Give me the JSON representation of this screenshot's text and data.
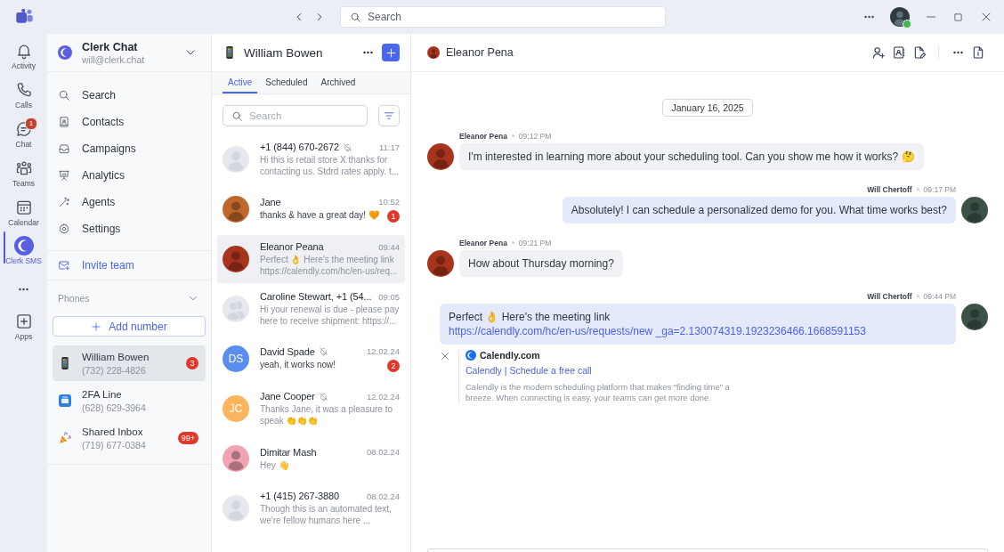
{
  "title_bar": {
    "search": {
      "placeholder": "Search"
    },
    "user": {
      "online": true
    }
  },
  "rail": {
    "items": [
      {
        "label": "Activity",
        "selected": false
      },
      {
        "label": "Calls",
        "selected": false
      },
      {
        "label": "Chat",
        "selected": false,
        "badge": "1"
      },
      {
        "label": "Teams",
        "selected": false
      },
      {
        "label": "Calendar",
        "selected": false
      },
      {
        "label": "Clerk SMS",
        "selected": true
      }
    ],
    "apps": {
      "label": "Apps"
    }
  },
  "sidebar": {
    "account": {
      "name": "Clerk Chat",
      "email": "will@clerk.chat"
    },
    "menu": [
      {
        "label": "Search"
      },
      {
        "label": "Contacts"
      },
      {
        "label": "Campaigns"
      },
      {
        "label": "Analytics"
      },
      {
        "label": "Agents"
      },
      {
        "label": "Settings"
      }
    ],
    "invite": {
      "label": "Invite team"
    },
    "phones": {
      "title": "Phones",
      "expanded": true,
      "add_label": "Add number",
      "lines": [
        {
          "name": "William Bowen",
          "number": "(732) 228-4826",
          "selected": true,
          "badge": "3"
        },
        {
          "name": "2FA Line",
          "number": "(628) 629-3964",
          "selected": false
        },
        {
          "name": "Shared Inbox",
          "number": "(719) 677-0384",
          "selected": false,
          "badge": "99+"
        }
      ]
    }
  },
  "conversations": {
    "title": "William Bowen",
    "tabs": [
      {
        "label": "Active",
        "selected": true
      },
      {
        "label": "Scheduled",
        "selected": false
      },
      {
        "label": "Archived",
        "selected": false
      }
    ],
    "search": {
      "placeholder": "Search"
    },
    "items": [
      {
        "name": "+1 (844) 670-2672",
        "time": "11:17",
        "preview": "Hi this is retail store X thanks for contacting us. Stdrd rates apply. t...",
        "muted": true,
        "selected": false,
        "avatar": {
          "kind": "placeholder"
        }
      },
      {
        "name": "Jane",
        "time": "10:52",
        "preview": "thanks & have a great day! 🧡",
        "muted": false,
        "selected": false,
        "badge": "1",
        "avatar": {
          "kind": "photo",
          "color": "#c0682c"
        }
      },
      {
        "name": "Eleanor Peana",
        "time": "09:44",
        "preview": "Perfect 👌 Here's the meeting link https://calendly.com/hc/en-us/req...",
        "muted": false,
        "selected": true,
        "avatar": {
          "kind": "photo",
          "color": "#a8341d"
        }
      },
      {
        "name": "Caroline Stewart, +1 (54...",
        "time": "09:05",
        "preview": "Hi your renewal is due - please pay here to receive shipment: https://...",
        "muted": false,
        "selected": false,
        "avatar": {
          "kind": "group"
        }
      },
      {
        "name": "David Spade",
        "time": "12.02.24",
        "preview": "yeah, it works now!",
        "muted": true,
        "selected": false,
        "badge": "2",
        "avatar": {
          "kind": "initials",
          "initials": "DS",
          "color": "#5b8def"
        }
      },
      {
        "name": "Jane Cooper",
        "time": "12.02.24",
        "preview": "Thanks Jane, it was a pleasure to speak 👏👏👏",
        "muted": true,
        "selected": false,
        "avatar": {
          "kind": "initials",
          "initials": "JC",
          "color": "#fbb55c"
        }
      },
      {
        "name": "Dimitar Mash",
        "time": "08.02.24",
        "preview": "Hey 👋",
        "muted": false,
        "selected": false,
        "avatar": {
          "kind": "photo",
          "color": "#f2a3b3"
        }
      },
      {
        "name": "+1 (415) 267-3880",
        "time": "08.02.24",
        "preview": "Though this is an automated text, we're fellow humans here ...",
        "muted": false,
        "selected": false,
        "avatar": {
          "kind": "placeholder"
        }
      }
    ]
  },
  "chat": {
    "contact": {
      "name": "Eleanor Pena",
      "avatar": {
        "color": "#a8341d"
      }
    },
    "date": "January 16, 2025",
    "messages": [
      {
        "outgoing": false,
        "sender": "Eleanor Pena",
        "time": "09:12 PM",
        "text": "I'm interested in learning more about your scheduling tool. Can you show me how it works? 🤔",
        "avatar": {
          "color": "#a8341d"
        }
      },
      {
        "outgoing": true,
        "sender": "Will Chertoff",
        "time": "09:17 PM",
        "text": "Absolutely! I can schedule a personalized demo for you. What time works best?",
        "avatar": {
          "color": "#3d5247"
        }
      },
      {
        "outgoing": false,
        "sender": "Eleanor Pena",
        "time": "09:21 PM",
        "text": "How about Thursday morning?",
        "avatar": {
          "color": "#a8341d"
        }
      },
      {
        "outgoing": true,
        "sender": "Will Chertoff",
        "time": "09:44 PM",
        "text": "Perfect 👌 Here's the meeting link",
        "link": "https://calendly.com/hc/en-us/requests/new _ga=2.130074319.1923236466.1668591153",
        "avatar": {
          "color": "#3d5247"
        },
        "preview": {
          "site": "Calendly.com",
          "title": "Calendly | Schedule a free call",
          "description": "Calendly is the modern scheduling platform that makes “finding time” a breeze. When connecting is easy, your teams can get more done."
        }
      }
    ]
  }
}
